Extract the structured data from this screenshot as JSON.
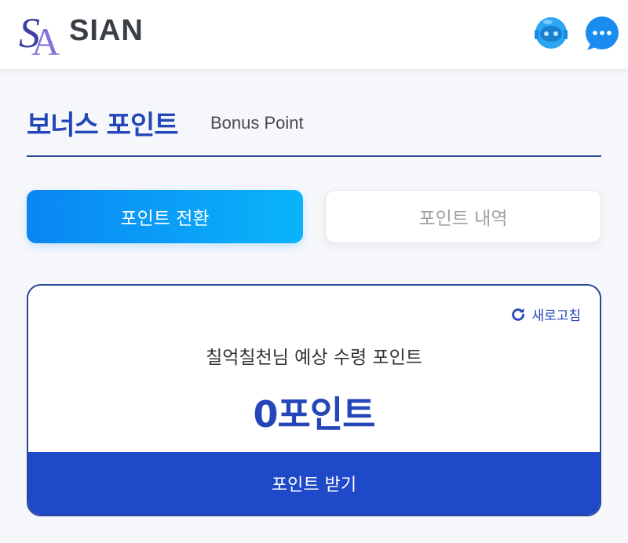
{
  "header": {
    "brand": "SIAN",
    "icons": {
      "bot": "robot-avatar-icon",
      "chat": "chat-bubble-icon"
    },
    "colors": {
      "logo": "#3b3fa0",
      "bot": "#2aa6f3",
      "chat": "#1a8cf0"
    }
  },
  "page": {
    "title_ko": "보너스 포인트",
    "title_en": "Bonus Point"
  },
  "tabs": [
    {
      "label": "포인트 전환",
      "active": true
    },
    {
      "label": "포인트 내역",
      "active": false
    }
  ],
  "card": {
    "refresh_label": "새로고침",
    "expected_label": "칠억칠천님 예상 수령 포인트",
    "points_value": "0포인트",
    "receive_button": "포인트 받기"
  },
  "colors": {
    "accent": "#2446b8",
    "tab_gradient_start": "#0a86f2",
    "tab_gradient_end": "#0ab4fb",
    "button": "#1e49c9",
    "card_border": "#2a4797"
  }
}
